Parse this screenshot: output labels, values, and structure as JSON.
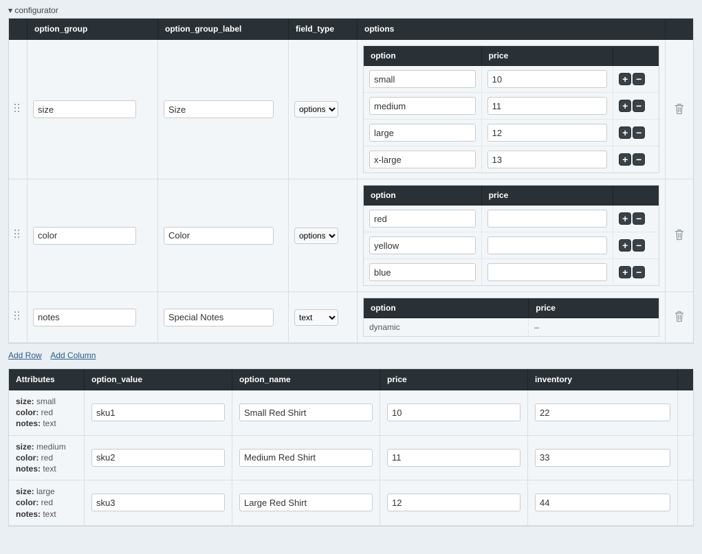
{
  "section_title": "configurator",
  "top_table": {
    "headers": {
      "option_group": "option_group",
      "option_group_label": "option_group_label",
      "field_type": "field_type",
      "options": "options"
    },
    "nested_headers": {
      "option": "option",
      "price": "price"
    },
    "rows": [
      {
        "option_group": "size",
        "option_group_label": "Size",
        "field_type": "options",
        "nested": [
          {
            "option": "small",
            "price": "10"
          },
          {
            "option": "medium",
            "price": "11"
          },
          {
            "option": "large",
            "price": "12"
          },
          {
            "option": "x-large",
            "price": "13"
          }
        ]
      },
      {
        "option_group": "color",
        "option_group_label": "Color",
        "field_type": "options",
        "nested": [
          {
            "option": "red",
            "price": ""
          },
          {
            "option": "yellow",
            "price": ""
          },
          {
            "option": "blue",
            "price": ""
          }
        ]
      },
      {
        "option_group": "notes",
        "option_group_label": "Special Notes",
        "field_type": "text",
        "nested_static": {
          "option": "dynamic",
          "price": "–"
        }
      }
    ]
  },
  "links": {
    "add_row": "Add Row",
    "add_column": "Add Column"
  },
  "bottom_table": {
    "headers": {
      "attributes": "Attributes",
      "option_value": "option_value",
      "option_name": "option_name",
      "price": "price",
      "inventory": "inventory"
    },
    "rows": [
      {
        "attrs": [
          {
            "k": "size",
            "v": "small"
          },
          {
            "k": "color",
            "v": "red"
          },
          {
            "k": "notes",
            "v": "text"
          }
        ],
        "option_value": "sku1",
        "option_name": "Small Red Shirt",
        "price": "10",
        "inventory": "22"
      },
      {
        "attrs": [
          {
            "k": "size",
            "v": "medium"
          },
          {
            "k": "color",
            "v": "red"
          },
          {
            "k": "notes",
            "v": "text"
          }
        ],
        "option_value": "sku2",
        "option_name": "Medium Red Shirt",
        "price": "11",
        "inventory": "33"
      },
      {
        "attrs": [
          {
            "k": "size",
            "v": "large"
          },
          {
            "k": "color",
            "v": "red"
          },
          {
            "k": "notes",
            "v": "text"
          }
        ],
        "option_value": "sku3",
        "option_name": "Large Red Shirt",
        "price": "12",
        "inventory": "44"
      }
    ]
  },
  "field_type_options": [
    "options",
    "text"
  ]
}
